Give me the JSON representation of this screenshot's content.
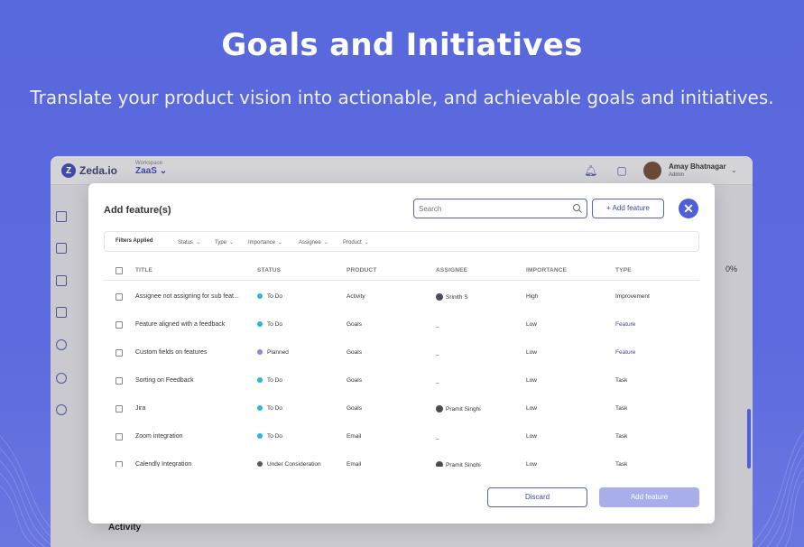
{
  "hero": {
    "title": "Goals and Initiatives",
    "subtitle": "Translate your product vision into actionable, and achievable goals and initiatives."
  },
  "app": {
    "logo_text": "Zeda.io",
    "workspace_label": "Workspace",
    "workspace_name": "ZaaS",
    "user_name": "Amay Bhatnagar",
    "user_role": "Admin",
    "background_percent": "0%",
    "background_section": "Activity"
  },
  "modal": {
    "title": "Add feature(s)",
    "search_placeholder": "Search",
    "add_button": "+ Add feature",
    "close_glyph": "✕",
    "filters_label": "Filters Applied",
    "filters": [
      "Status",
      "Type",
      "Importance",
      "Assignee",
      "Product"
    ],
    "columns": [
      "TITLE",
      "STATUS",
      "PRODUCT",
      "ASSIGNEE",
      "IMPORTANCE",
      "TYPE"
    ],
    "rows": [
      {
        "title": "Assignee not assigning for sub feat...",
        "status": "To Do",
        "status_color": "#2bb5e0",
        "product": "Activity",
        "assignee": "Srinith S",
        "importance": "High",
        "type": "Improvement",
        "type_link": false
      },
      {
        "title": "Feature aligned with a feedback",
        "status": "To Do",
        "status_color": "#2bb5e0",
        "product": "Goals",
        "assignee": "_",
        "importance": "Low",
        "type": "Feature",
        "type_link": true
      },
      {
        "title": "Custom fields on features",
        "status": "Planned",
        "status_color": "#8f86d6",
        "product": "Goals",
        "assignee": "_",
        "importance": "Low",
        "type": "Feature",
        "type_link": true
      },
      {
        "title": "Sorting on Feedback",
        "status": "To Do",
        "status_color": "#2bb5e0",
        "product": "Goals",
        "assignee": "_",
        "importance": "Low",
        "type": "Task",
        "type_link": false
      },
      {
        "title": "Jira",
        "status": "To Do",
        "status_color": "#2bb5e0",
        "product": "Goals",
        "assignee": "Pramit Singhi",
        "importance": "Low",
        "type": "Task",
        "type_link": false
      },
      {
        "title": "Zoom integration",
        "status": "To Do",
        "status_color": "#2bb5e0",
        "product": "Email",
        "assignee": "_",
        "importance": "Low",
        "type": "Task",
        "type_link": false
      },
      {
        "title": "Calendly Integration",
        "status": "Under Consideration",
        "status_color": "#5a5a66",
        "product": "Email",
        "assignee": "Pramit Singhi",
        "importance": "Low",
        "type": "Task",
        "type_link": false
      }
    ],
    "discard_button": "Discard",
    "submit_button": "Add feature"
  }
}
